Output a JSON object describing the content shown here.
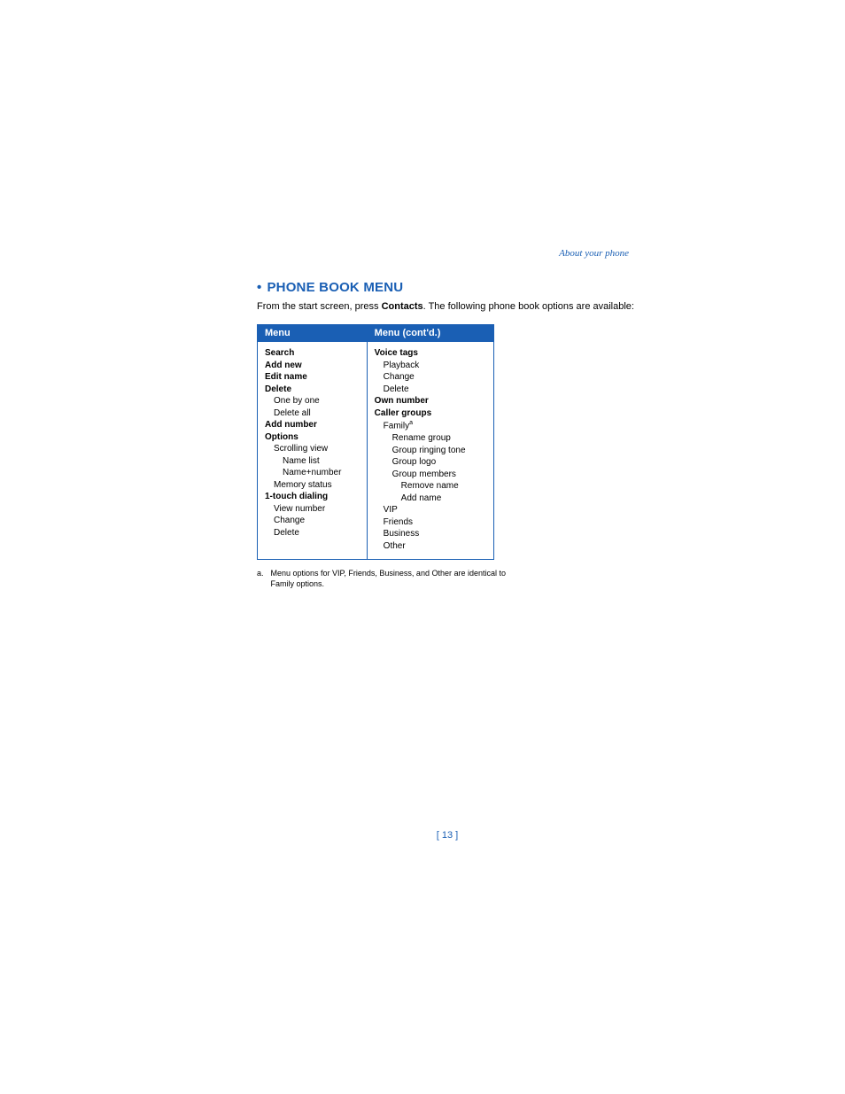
{
  "breadcrumb": "About your phone",
  "heading": "PHONE BOOK MENU",
  "intro_prefix": "From the start screen, press ",
  "intro_bold": "Contacts",
  "intro_suffix": ". The following phone book options are available:",
  "table": {
    "col1_header": "Menu",
    "col2_header": "Menu (cont'd.)",
    "col1": [
      {
        "text": "Search",
        "bold": true,
        "indent": 0
      },
      {
        "text": "Add new",
        "bold": true,
        "indent": 0
      },
      {
        "text": "Edit name",
        "bold": true,
        "indent": 0
      },
      {
        "text": "Delete",
        "bold": true,
        "indent": 0
      },
      {
        "text": "One by one",
        "bold": false,
        "indent": 1
      },
      {
        "text": "Delete all",
        "bold": false,
        "indent": 1
      },
      {
        "text": "Add number",
        "bold": true,
        "indent": 0
      },
      {
        "text": "Options",
        "bold": true,
        "indent": 0
      },
      {
        "text": "Scrolling view",
        "bold": false,
        "indent": 1
      },
      {
        "text": "Name list",
        "bold": false,
        "indent": 2
      },
      {
        "text": "Name+number",
        "bold": false,
        "indent": 2
      },
      {
        "text": "Memory status",
        "bold": false,
        "indent": 1
      },
      {
        "text": "1-touch dialing",
        "bold": true,
        "indent": 0
      },
      {
        "text": "View number",
        "bold": false,
        "indent": 1
      },
      {
        "text": "Change",
        "bold": false,
        "indent": 1
      },
      {
        "text": "Delete",
        "bold": false,
        "indent": 1
      }
    ],
    "col2": [
      {
        "text": "Voice tags",
        "bold": true,
        "indent": 0
      },
      {
        "text": "Playback",
        "bold": false,
        "indent": 1
      },
      {
        "text": "Change",
        "bold": false,
        "indent": 1
      },
      {
        "text": "Delete",
        "bold": false,
        "indent": 1
      },
      {
        "text": "Own number",
        "bold": true,
        "indent": 0
      },
      {
        "text": "Caller groups",
        "bold": true,
        "indent": 0
      },
      {
        "text": "Family",
        "bold": false,
        "indent": 1,
        "sup": "a"
      },
      {
        "text": "Rename group",
        "bold": false,
        "indent": 2
      },
      {
        "text": "Group ringing tone",
        "bold": false,
        "indent": 2
      },
      {
        "text": "Group logo",
        "bold": false,
        "indent": 2
      },
      {
        "text": "Group members",
        "bold": false,
        "indent": 2
      },
      {
        "text": "Remove name",
        "bold": false,
        "indent": 3
      },
      {
        "text": "Add name",
        "bold": false,
        "indent": 3
      },
      {
        "text": "VIP",
        "bold": false,
        "indent": 1
      },
      {
        "text": "Friends",
        "bold": false,
        "indent": 1
      },
      {
        "text": "Business",
        "bold": false,
        "indent": 1
      },
      {
        "text": "Other",
        "bold": false,
        "indent": 1
      }
    ]
  },
  "footnote_label": "a.",
  "footnote_text": "Menu options for VIP, Friends, Business, and Other are identical to Family options.",
  "page_number": "[ 13 ]"
}
